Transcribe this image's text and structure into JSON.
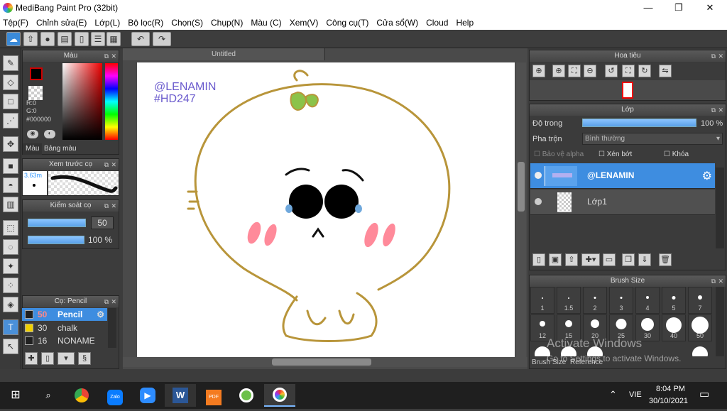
{
  "window": {
    "title": "MediBang Paint Pro (32bit)",
    "minimize": "—",
    "maximize": "❐",
    "close": "✕"
  },
  "menu": [
    "Tệp(F)",
    "Chỉnh sửa(E)",
    "Lớp(L)",
    "Bộ lọc(R)",
    "Chọn(S)",
    "Chụp(N)",
    "Màu (C)",
    "Xem(V)",
    "Công cụ(T)",
    "Cửa sổ(W)",
    "Cloud",
    "Help"
  ],
  "toolbar_icons": [
    "cloud-icon",
    "upload-icon",
    "comment-icon",
    "speech-icon",
    "page-icon",
    "list-icon",
    "grid-icon",
    "undo-icon",
    "redo-icon"
  ],
  "color_panel": {
    "title": "Màu",
    "r": "R:0",
    "g": "G:0",
    "hex": "#000000",
    "tabs": [
      "Màu",
      "Bảng màu"
    ],
    "primary": "#000000",
    "secondary": "#e0a020"
  },
  "brush_preview": {
    "title": "Xem trước cọ",
    "size": "3.63m"
  },
  "brush_control": {
    "title": "Kiểm soát cọ",
    "size_value": "50",
    "opacity_value": "100 %",
    "size_fraction": 0.5,
    "opacity_fraction": 1.0
  },
  "brush_list": {
    "title": "Cọ: Pencil",
    "items": [
      {
        "size": "50",
        "name": "Pencil",
        "color": "#202020",
        "active": true
      },
      {
        "size": "30",
        "name": "chalk",
        "color": "#f0d000",
        "active": false
      },
      {
        "size": "16",
        "name": "NONAME",
        "color": "#202020",
        "active": false
      }
    ]
  },
  "document": {
    "tab": "Untitled",
    "watermark_line1": "@LENAMIN",
    "watermark_line2": "#HD247"
  },
  "navigator": {
    "title": "Hoa tiêu"
  },
  "layer_panel": {
    "title": "Lớp",
    "opacity_label": "Độ trong",
    "opacity_value": "100 %",
    "opacity_fraction": 1.0,
    "blend_label": "Pha trộn",
    "blend_value": "Bình thường",
    "protect_alpha": "Bảo vệ alpha",
    "clip": "Xén bớt",
    "lock": "Khóa",
    "layers": [
      {
        "name": "@LENAMIN",
        "selected": true
      },
      {
        "name": "Lớp1",
        "selected": false
      }
    ]
  },
  "brush_size_panel": {
    "title": "Brush Size",
    "sizes": [
      "1",
      "1.5",
      "2",
      "3",
      "4",
      "5",
      "7",
      "12",
      "15",
      "20",
      "25",
      "30",
      "40",
      "50"
    ],
    "tabs": [
      "Brush Size",
      "Reference"
    ]
  },
  "activation": {
    "line1": "Activate Windows",
    "line2": "Go to Settings to activate Windows."
  },
  "taskbar": {
    "lang": "VIE",
    "time": "8:04 PM",
    "date": "30/10/2021",
    "apps": [
      "Zalo",
      "PDF"
    ]
  }
}
